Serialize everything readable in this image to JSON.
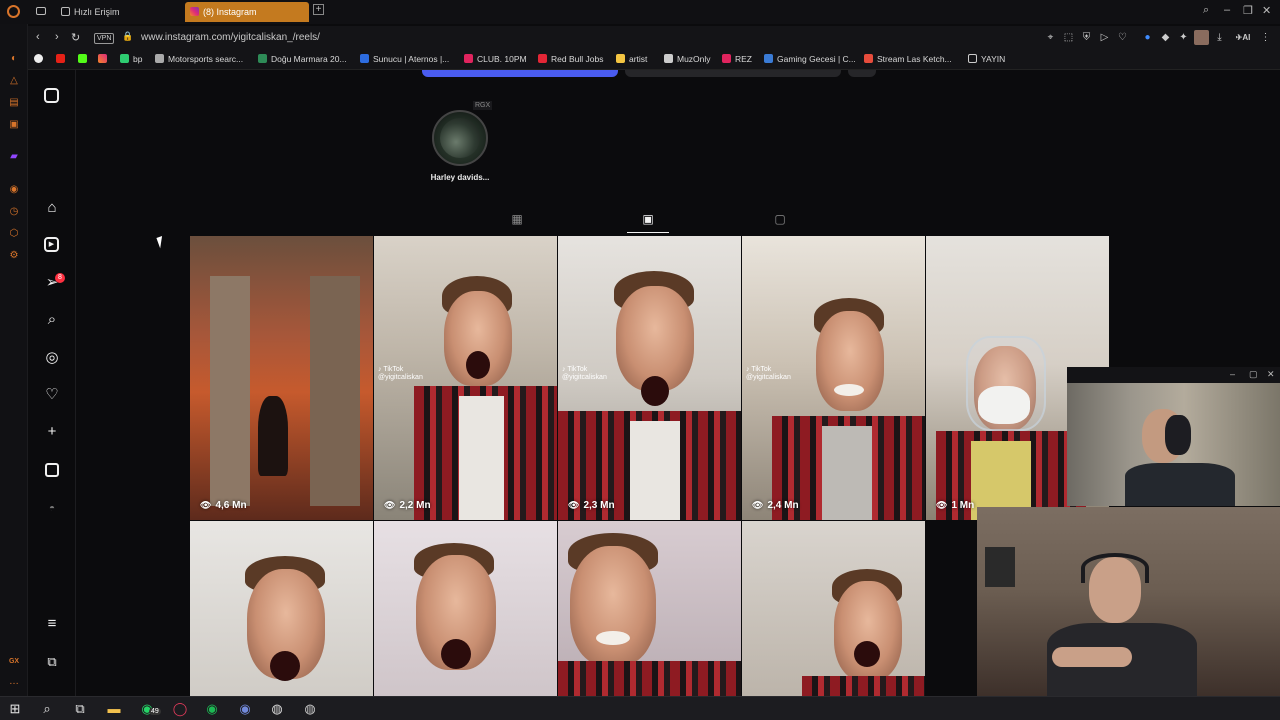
{
  "browser": {
    "tabs": [
      {
        "label": "Hızlı Erişim",
        "active": false
      },
      {
        "label": "(8) Instagram",
        "active": true
      }
    ],
    "vpn_label": "VPN",
    "url": "www.instagram.com/yigitcaliskan_/reels/",
    "ai_label": "AI",
    "accent": "#c47a1f"
  },
  "bookmarks": [
    {
      "label": "bp",
      "color": "#2ecc71"
    },
    {
      "label": "Motorsports searc...",
      "color": "#aaaaaa"
    },
    {
      "label": "Doğu Marmara 20...",
      "color": "#2e8b57"
    },
    {
      "label": "Sunucu | Aternos |...",
      "color": "#2d6cdf"
    },
    {
      "label": "CLUB. 10PM",
      "color": "#e0245e"
    },
    {
      "label": "Red Bull Jobs",
      "color": "#e32636"
    },
    {
      "label": "artist",
      "color": "#f4c542"
    },
    {
      "label": "MuzOnly",
      "color": "#cccccc"
    },
    {
      "label": "REZ",
      "color": "#e0245e"
    },
    {
      "label": "Gaming Gecesi | C...",
      "color": "#3a7bd5"
    },
    {
      "label": "Stream Las Ketch...",
      "color": "#e74c3c"
    },
    {
      "label": "YAYIN",
      "color": "#cccccc"
    }
  ],
  "sidebar": {
    "notification_count": "8",
    "items": [
      "instagram-logo",
      "home",
      "reels",
      "messages",
      "search",
      "explore",
      "notifications",
      "create",
      "dashboard",
      "profile",
      "more",
      "also-from-meta"
    ]
  },
  "profile": {
    "highlight_label": "Harley davids...",
    "highlight_badge": "RGX"
  },
  "reels": [
    {
      "views": "4,6 Mn",
      "scene": "hallway",
      "tiktok": false
    },
    {
      "views": "2,2 Mn",
      "scene": "scream",
      "tiktok": true
    },
    {
      "views": "2,3 Mn",
      "scene": "scream",
      "tiktok": true
    },
    {
      "views": "2,4 Mn",
      "scene": "grin",
      "tiktok": true
    },
    {
      "views": "1 Mn",
      "scene": "mask",
      "tiktok": false
    },
    {
      "views": "",
      "scene": "scream2",
      "tiktok": false
    },
    {
      "views": "",
      "scene": "scream2",
      "tiktok": false
    },
    {
      "views": "",
      "scene": "grin2",
      "tiktok": false
    },
    {
      "views": "",
      "scene": "scream2",
      "tiktok": false
    }
  ],
  "tiktok": {
    "brand": "TikTok",
    "handle": "@yigitcaliskan"
  },
  "taskbar": {
    "whatsapp_badge": "49"
  }
}
